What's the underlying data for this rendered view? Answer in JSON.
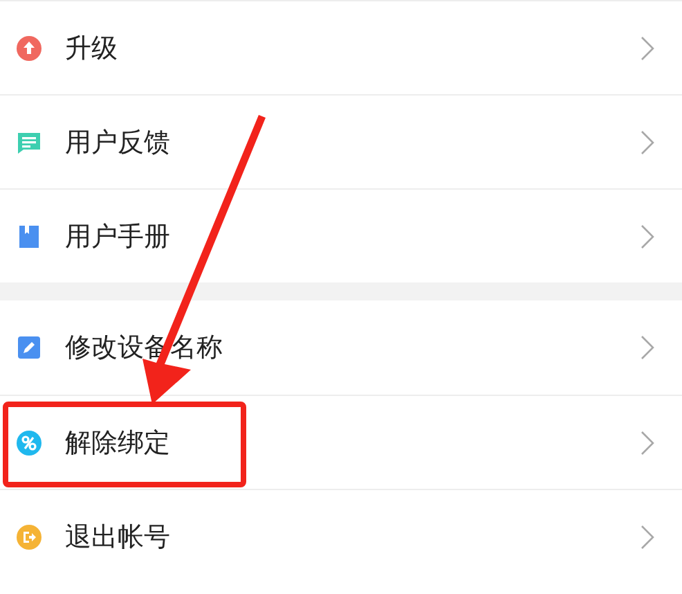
{
  "sections": [
    {
      "items": [
        {
          "label": "升级",
          "color": "#f0685f",
          "highlighted": false
        },
        {
          "label": "用户反馈",
          "color": "#3dcfb0",
          "highlighted": false
        },
        {
          "label": "用户手册",
          "color": "#4a90f0",
          "highlighted": false
        }
      ]
    },
    {
      "items": [
        {
          "label": "修改设备名称",
          "color": "#4a90f0",
          "highlighted": false
        },
        {
          "label": "解除绑定",
          "color": "#1fb8ee",
          "highlighted": true
        },
        {
          "label": "退出帐号",
          "color": "#f5b335",
          "highlighted": false
        }
      ]
    }
  ]
}
